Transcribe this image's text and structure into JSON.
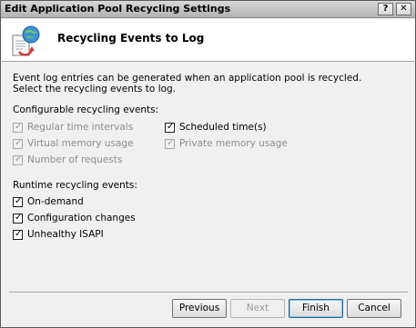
{
  "window": {
    "title": "Edit Application Pool Recycling Settings",
    "help_label": "?",
    "close_label": "✕"
  },
  "header": {
    "title": "Recycling Events to Log",
    "icon": "recycle-globe-document-icon"
  },
  "content": {
    "description": "Event log entries can be generated when an application pool is recycled. Select the recycling events to log.",
    "configurable_label": "Configurable recycling events:",
    "configurable": [
      {
        "label": "Regular time intervals",
        "checked": true,
        "enabled": false
      },
      {
        "label": "Virtual memory usage",
        "checked": true,
        "enabled": false
      },
      {
        "label": "Number of requests",
        "checked": true,
        "enabled": false
      },
      {
        "label": "Scheduled time(s)",
        "checked": true,
        "enabled": true
      },
      {
        "label": "Private memory usage",
        "checked": true,
        "enabled": false
      }
    ],
    "runtime_label": "Runtime recycling events:",
    "runtime": [
      {
        "label": "On-demand",
        "checked": true,
        "enabled": true
      },
      {
        "label": "Configuration changes",
        "checked": true,
        "enabled": true
      },
      {
        "label": "Unhealthy ISAPI",
        "checked": true,
        "enabled": true
      }
    ]
  },
  "footer": {
    "previous": "Previous",
    "next": "Next",
    "finish": "Finish",
    "cancel": "Cancel"
  },
  "colors": {
    "accent_blue": "#2c628b",
    "disabled_text": "#8d8d8d"
  }
}
